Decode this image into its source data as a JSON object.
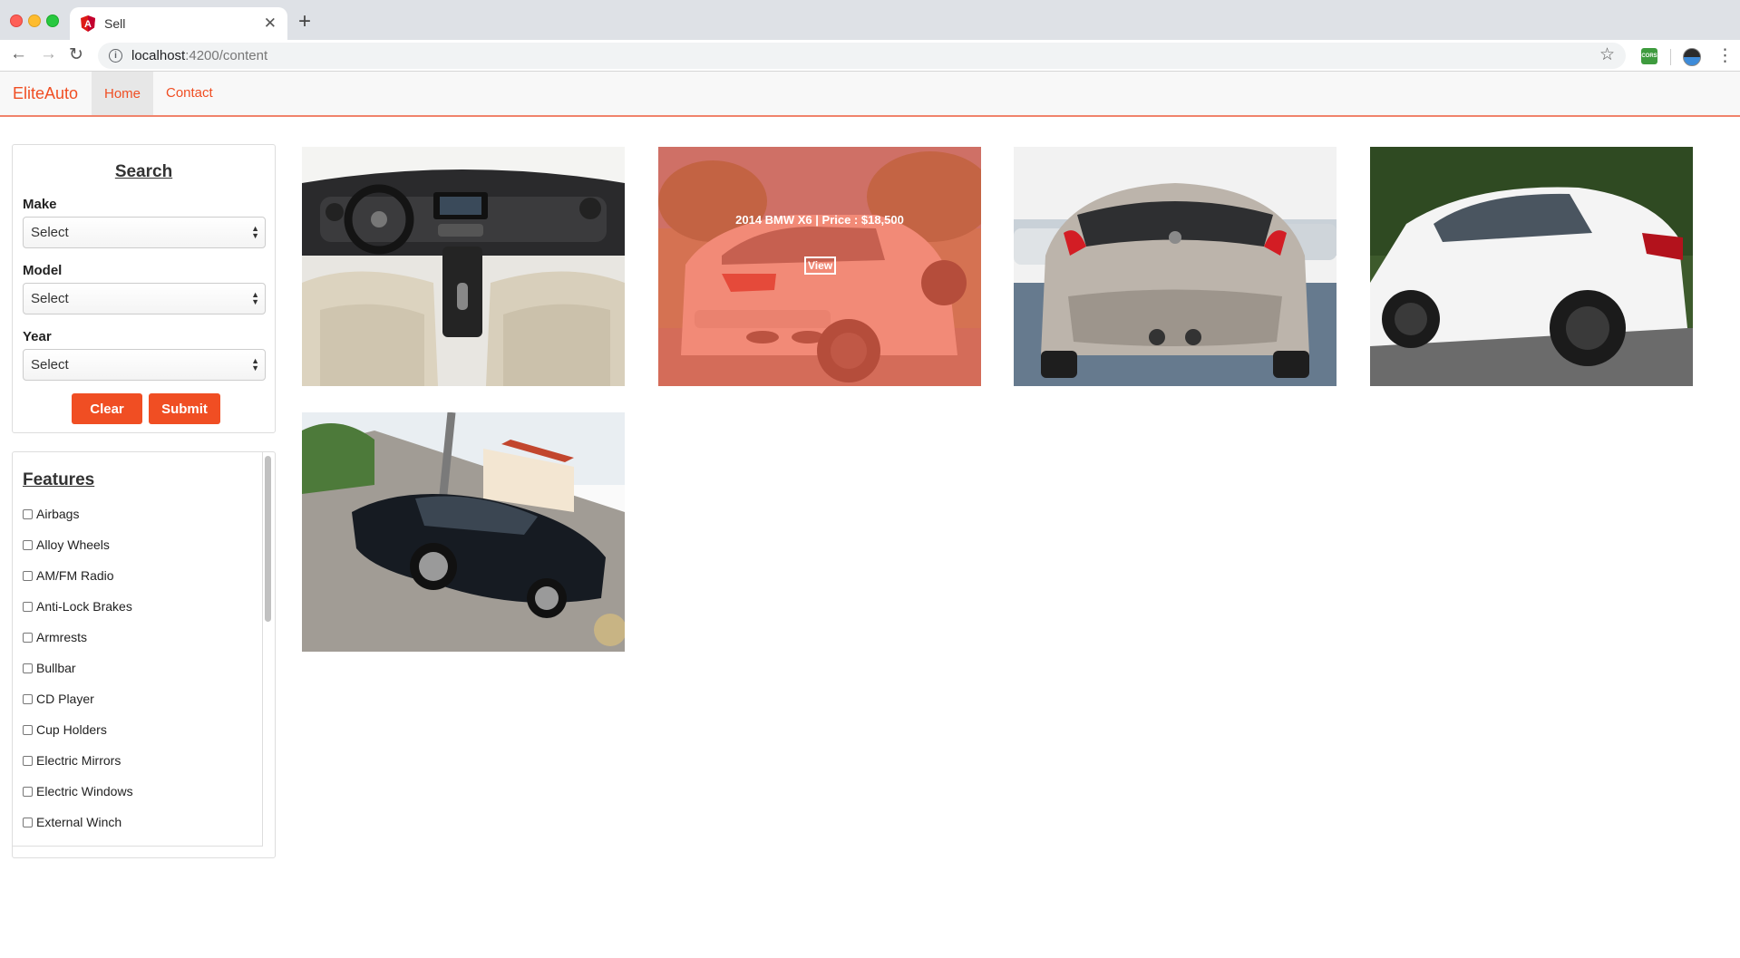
{
  "browser": {
    "tab_title": "Sell",
    "url_host": "localhost",
    "url_path": ":4200/content",
    "ext_cors_label": "CORS"
  },
  "navbar": {
    "brand": "EliteAuto",
    "links": [
      "Home",
      "Contact"
    ]
  },
  "search": {
    "title": "Search",
    "fields": [
      {
        "label": "Make",
        "value": "Select"
      },
      {
        "label": "Model",
        "value": "Select"
      },
      {
        "label": "Year",
        "value": "Select"
      }
    ],
    "clear_label": "Clear",
    "submit_label": "Submit"
  },
  "features": {
    "title": "Features",
    "items": [
      "Airbags",
      "Alloy Wheels",
      "AM/FM Radio",
      "Anti-Lock Brakes",
      "Armrests",
      "Bullbar",
      "CD Player",
      "Cup Holders",
      "Electric Mirrors",
      "Electric Windows",
      "External Winch"
    ]
  },
  "listings": [
    {
      "photo": "car interior dashboard"
    },
    {
      "photo": "white suv rear",
      "caption": "2014 BMW X6 | Price : $18,500",
      "view_label": "View"
    },
    {
      "photo": "silver hatchback rear"
    },
    {
      "photo": "white sedan side"
    },
    {
      "photo": "black sedan angled"
    }
  ]
}
